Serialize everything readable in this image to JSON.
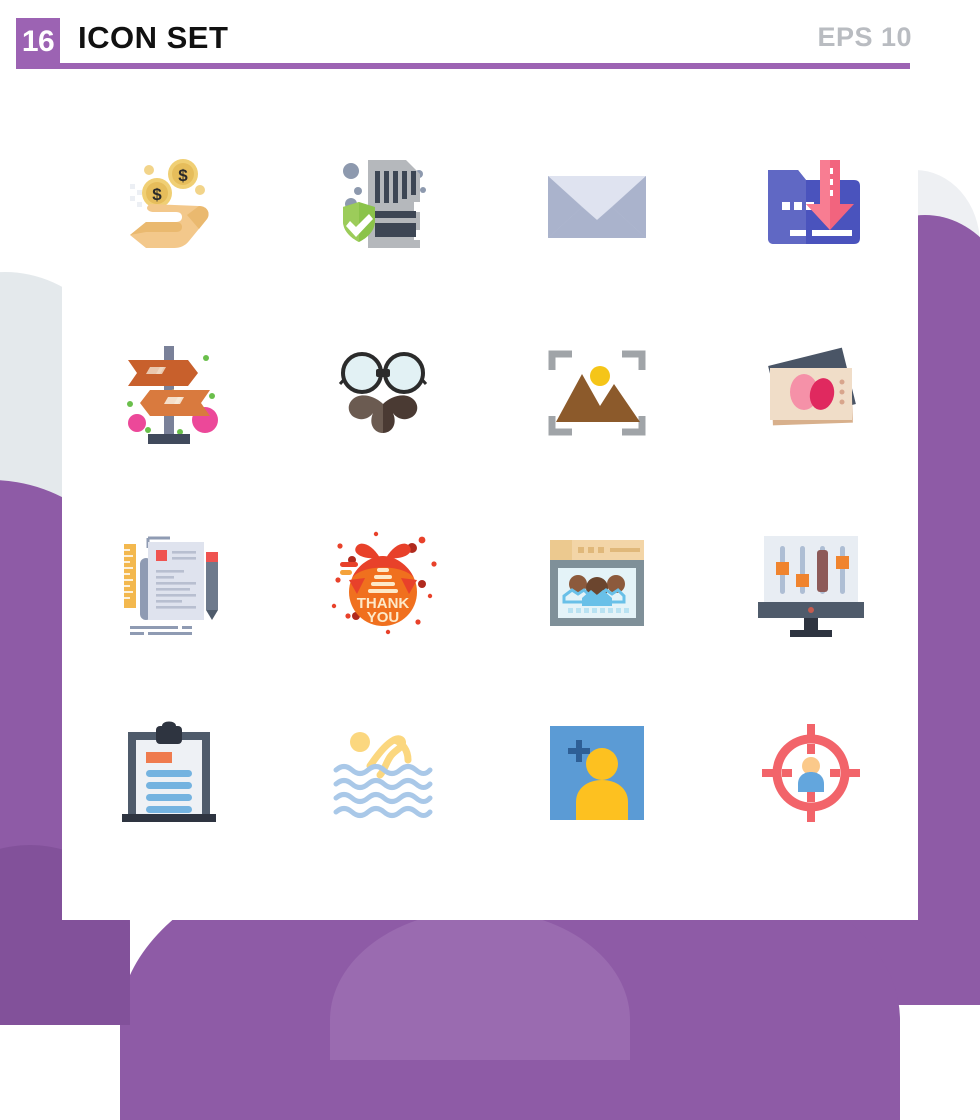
{
  "header": {
    "count": "16",
    "title": "ICON SET",
    "format_label": "EPS 10",
    "accent_color": "#9c63b3",
    "title_color": "#111111",
    "format_color": "#b9bcc1"
  },
  "background": {
    "page_color": "#ffffff",
    "purple": "#8e5ba6",
    "purple_dark": "#82519a",
    "grey": "#e4e9ec"
  },
  "grid": {
    "columns": 4,
    "rows": 4,
    "total": 16
  },
  "icons": [
    {
      "index": 1,
      "name": "money-in-hand-icon",
      "label": "Receive Money",
      "colors": [
        "#f3c88b",
        "#eab96f",
        "#f0cf74",
        "#e6bd5b",
        "#2b2b2b"
      ]
    },
    {
      "index": 2,
      "name": "secure-memory-card-icon",
      "label": "Secure Memory Card",
      "colors": [
        "#b5b8bc",
        "#3d4654",
        "#8bc34a",
        "#7cb342",
        "#8d99ae"
      ]
    },
    {
      "index": 3,
      "name": "envelope-mail-icon",
      "label": "Email Envelope",
      "colors": [
        "#dfe3f0",
        "#aab3cc",
        "#c3cadd"
      ]
    },
    {
      "index": 4,
      "name": "folder-download-icon",
      "label": "Download Folder",
      "colors": [
        "#3b4cb8",
        "#5b63c4",
        "#6b63b5",
        "#f2647e",
        "#ffffff"
      ]
    },
    {
      "index": 5,
      "name": "signpost-directions-icon",
      "label": "Direction Signpost",
      "colors": [
        "#c8602c",
        "#d97a3e",
        "#7a8199",
        "#414a5c",
        "#ec4899",
        "#6abf4b",
        "#f6c344"
      ]
    },
    {
      "index": 6,
      "name": "hipster-glasses-mustache-icon",
      "label": "Hipster Glasses and Mustache",
      "colors": [
        "#e2f1f4",
        "#2b2b2b",
        "#6b5b51",
        "#4a3a33"
      ]
    },
    {
      "index": 7,
      "name": "image-focus-frame-icon",
      "label": "Photo Focus Frame",
      "colors": [
        "#a0a4a8",
        "#8c5a2b",
        "#f5c518"
      ]
    },
    {
      "index": 8,
      "name": "photo-gallery-stack-icon",
      "label": "Photo Stack",
      "colors": [
        "#4a5566",
        "#f0ddc8",
        "#f591a8",
        "#e0295f",
        "#d8b08c"
      ]
    },
    {
      "index": 9,
      "name": "document-ruler-pencil-icon",
      "label": "Document with Ruler and Pencil",
      "colors": [
        "#f3b84e",
        "#8f9bb3",
        "#dfe3ee",
        "#6e7a8c",
        "#ef5350",
        "#d2d6e3"
      ]
    },
    {
      "index": 10,
      "name": "thank-you-badge-icon",
      "label": "Thank You Badge",
      "text": "THANK YOU",
      "colors": [
        "#f0701e",
        "#e8412a",
        "#b02a1e",
        "#f4a23a",
        "#fde9c8"
      ]
    },
    {
      "index": 11,
      "name": "team-webpage-icon",
      "label": "Team Web Page",
      "colors": [
        "#f3d5a7",
        "#7f9099",
        "#e4f3f8",
        "#8c5a3c",
        "#69c0e8",
        "#b8e2f2"
      ]
    },
    {
      "index": 12,
      "name": "monitor-equalizer-icon",
      "label": "Monitor Settings Sliders",
      "colors": [
        "#e8edf3",
        "#4f5b6b",
        "#aebed4",
        "#f0842e",
        "#8d5a58",
        "#2e3440"
      ]
    },
    {
      "index": 13,
      "name": "clipboard-checklist-icon",
      "label": "Clipboard Checklist",
      "colors": [
        "#4f5b6b",
        "#eef1f5",
        "#2e3440",
        "#74b3e0",
        "#ef7b4e"
      ]
    },
    {
      "index": 14,
      "name": "swimming-icon",
      "label": "Swimming",
      "colors": [
        "#fbd77f",
        "#a9c8e8",
        "#bcd6ef"
      ]
    },
    {
      "index": 15,
      "name": "add-user-icon",
      "label": "Add User",
      "colors": [
        "#5b9bd5",
        "#fdc120",
        "#2e5f96"
      ]
    },
    {
      "index": 16,
      "name": "target-audience-icon",
      "label": "Target Audience",
      "colors": [
        "#f2646a",
        "#fbc98a",
        "#63a6dd"
      ]
    }
  ]
}
